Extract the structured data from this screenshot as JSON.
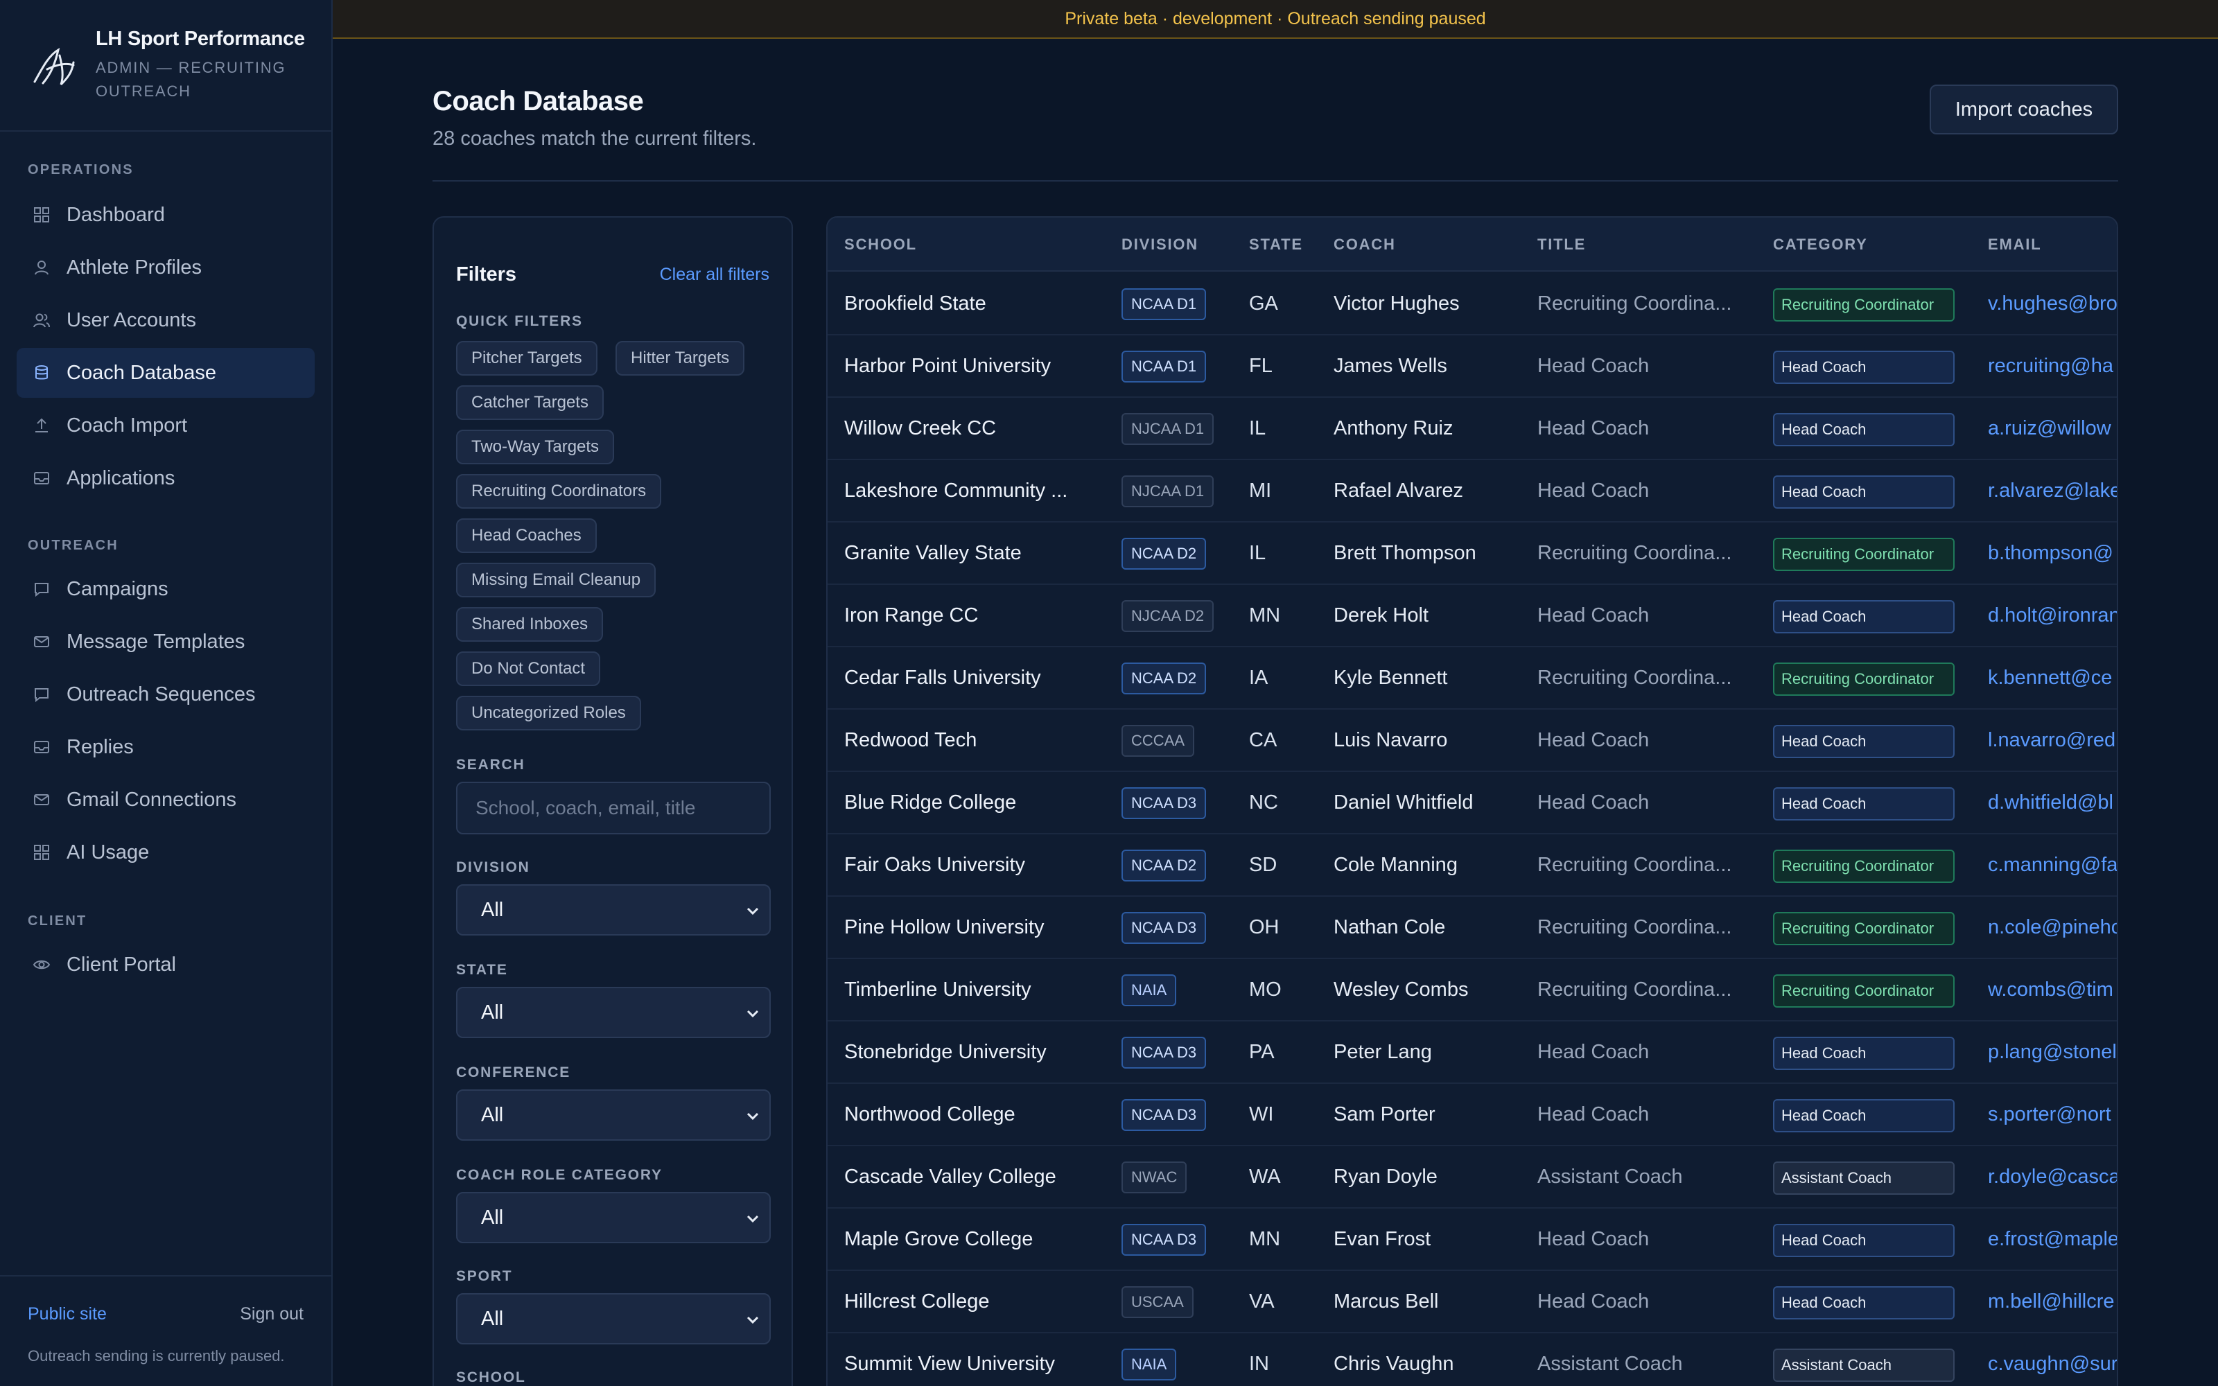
{
  "banner": "Private beta · development · Outreach sending paused",
  "brand": {
    "title": "LH Sport Performance",
    "subtitle": "ADMIN — RECRUITING OUTREACH"
  },
  "nav": {
    "operations_label": "OPERATIONS",
    "outreach_label": "OUTREACH",
    "client_label": "CLIENT",
    "items": [
      {
        "label": "Dashboard",
        "icon": "grid-icon"
      },
      {
        "label": "Athlete Profiles",
        "icon": "user-icon"
      },
      {
        "label": "User Accounts",
        "icon": "users-icon"
      },
      {
        "label": "Coach Database",
        "icon": "database-icon",
        "active": true
      },
      {
        "label": "Coach Import",
        "icon": "upload-icon"
      },
      {
        "label": "Applications",
        "icon": "inbox-icon"
      },
      {
        "label": "Campaigns",
        "icon": "message-icon"
      },
      {
        "label": "Message Templates",
        "icon": "mail-icon"
      },
      {
        "label": "Outreach Sequences",
        "icon": "message-icon"
      },
      {
        "label": "Replies",
        "icon": "inbox-icon"
      },
      {
        "label": "Gmail Connections",
        "icon": "mail-icon"
      },
      {
        "label": "AI Usage",
        "icon": "grid-icon"
      },
      {
        "label": "Client Portal",
        "icon": "eye-icon"
      }
    ]
  },
  "footer": {
    "public_site": "Public site",
    "sign_out": "Sign out",
    "note": "Outreach sending is currently paused."
  },
  "header": {
    "title": "Coach Database",
    "subtitle": "28 coaches match the current filters.",
    "import_label": "Import coaches"
  },
  "filters": {
    "title": "Filters",
    "clear": "Clear all filters",
    "quick_label": "QUICK FILTERS",
    "chips": [
      "Pitcher Targets",
      "Hitter Targets",
      "Catcher Targets",
      "Two-Way Targets",
      "Recruiting Coordinators",
      "Head Coaches",
      "Missing Email Cleanup",
      "Shared Inboxes",
      "Do Not Contact",
      "Uncategorized Roles"
    ],
    "search_label": "SEARCH",
    "search_placeholder": "School, coach, email, title",
    "division_label": "DIVISION",
    "division_value": "All",
    "state_label": "STATE",
    "state_value": "All",
    "conference_label": "CONFERENCE",
    "conference_value": "All",
    "role_label": "COACH ROLE CATEGORY",
    "role_value": "All",
    "sport_label": "SPORT",
    "sport_value": "All",
    "school_label": "SCHOOL"
  },
  "table": {
    "columns": [
      "SCHOOL",
      "DIVISION",
      "STATE",
      "COACH",
      "TITLE",
      "CATEGORY",
      "EMAIL"
    ],
    "rows": [
      [
        "Brookfield State",
        "NCAA D1",
        "GA",
        "Victor Hughes",
        "Recruiting Coordina...",
        "Recruiting Coordinator",
        "v.hughes@bro"
      ],
      [
        "Harbor Point University",
        "NCAA D1",
        "FL",
        "James Wells",
        "Head Coach",
        "Head Coach",
        "recruiting@ha"
      ],
      [
        "Willow Creek CC",
        "NJCAA D1",
        "IL",
        "Anthony Ruiz",
        "Head Coach",
        "Head Coach",
        "a.ruiz@willow"
      ],
      [
        "Lakeshore Community ...",
        "NJCAA D1",
        "MI",
        "Rafael Alvarez",
        "Head Coach",
        "Head Coach",
        "r.alvarez@lake"
      ],
      [
        "Granite Valley State",
        "NCAA D2",
        "IL",
        "Brett Thompson",
        "Recruiting Coordina...",
        "Recruiting Coordinator",
        "b.thompson@"
      ],
      [
        "Iron Range CC",
        "NJCAA D2",
        "MN",
        "Derek Holt",
        "Head Coach",
        "Head Coach",
        "d.holt@ironran"
      ],
      [
        "Cedar Falls University",
        "NCAA D2",
        "IA",
        "Kyle Bennett",
        "Recruiting Coordina...",
        "Recruiting Coordinator",
        "k.bennett@ce"
      ],
      [
        "Redwood Tech",
        "CCCAA",
        "CA",
        "Luis Navarro",
        "Head Coach",
        "Head Coach",
        "l.navarro@red"
      ],
      [
        "Blue Ridge College",
        "NCAA D3",
        "NC",
        "Daniel Whitfield",
        "Head Coach",
        "Head Coach",
        "d.whitfield@bl"
      ],
      [
        "Fair Oaks University",
        "NCAA D2",
        "SD",
        "Cole Manning",
        "Recruiting Coordina...",
        "Recruiting Coordinator",
        "c.manning@fa"
      ],
      [
        "Pine Hollow University",
        "NCAA D3",
        "OH",
        "Nathan Cole",
        "Recruiting Coordina...",
        "Recruiting Coordinator",
        "n.cole@pineho"
      ],
      [
        "Timberline University",
        "NAIA",
        "MO",
        "Wesley Combs",
        "Recruiting Coordina...",
        "Recruiting Coordinator",
        "w.combs@tim"
      ],
      [
        "Stonebridge University",
        "NCAA D3",
        "PA",
        "Peter Lang",
        "Head Coach",
        "Head Coach",
        "p.lang@stonel"
      ],
      [
        "Northwood College",
        "NCAA D3",
        "WI",
        "Sam Porter",
        "Head Coach",
        "Head Coach",
        "s.porter@nort"
      ],
      [
        "Cascade Valley College",
        "NWAC",
        "WA",
        "Ryan Doyle",
        "Assistant Coach",
        "Assistant Coach",
        "r.doyle@casca"
      ],
      [
        "Maple Grove College",
        "NCAA D3",
        "MN",
        "Evan Frost",
        "Head Coach",
        "Head Coach",
        "e.frost@maple"
      ],
      [
        "Hillcrest College",
        "USCAA",
        "VA",
        "Marcus Bell",
        "Head Coach",
        "Head Coach",
        "m.bell@hillcre"
      ],
      [
        "Summit View University",
        "NAIA",
        "IN",
        "Chris Vaughn",
        "Assistant Coach",
        "Assistant Coach",
        "c.vaughn@sur"
      ]
    ]
  }
}
